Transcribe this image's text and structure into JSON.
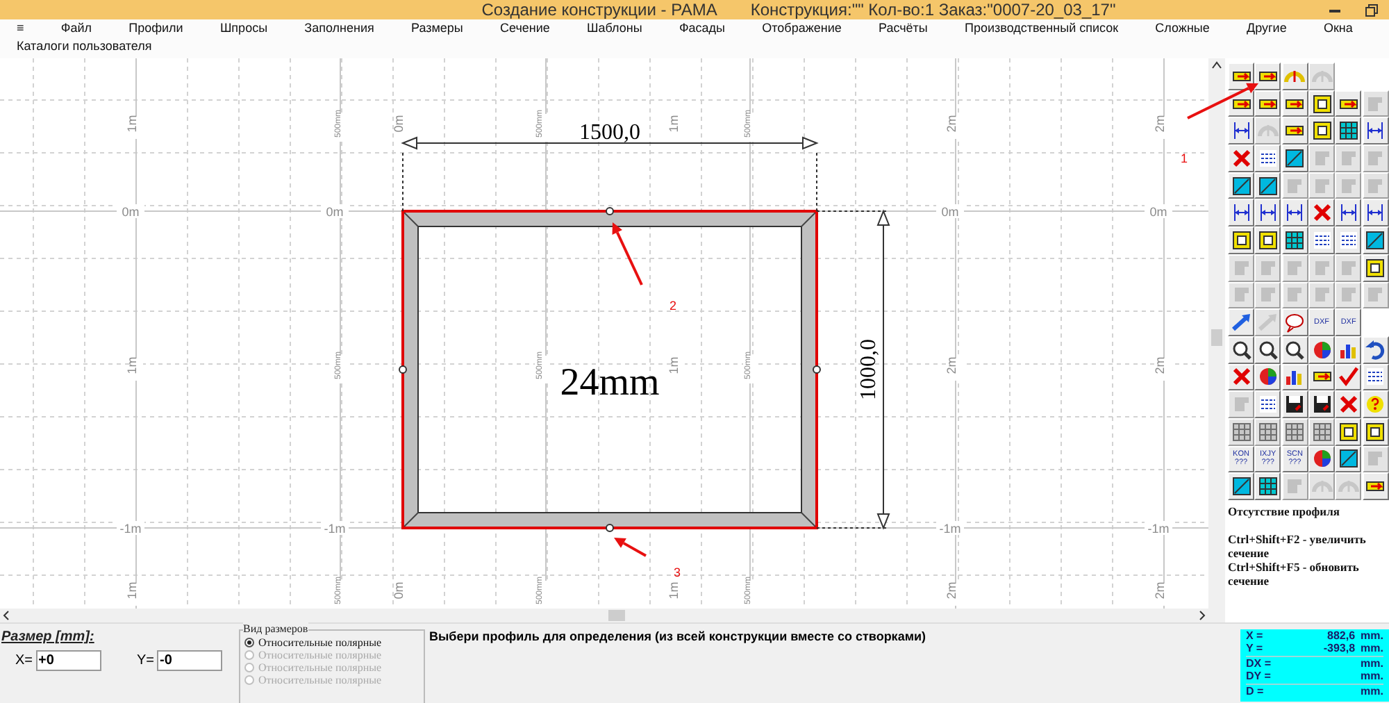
{
  "window": {
    "title": "Создание конструкции - РАМА",
    "info": "Конструкция:\"\" Кол-во:1 Заказ:\"0007-20_03_17\""
  },
  "menu": [
    "≡",
    "Файл",
    "Профили",
    "Шпросы",
    "Заполнения",
    "Размеры",
    "Сечение",
    "Шаблоны",
    "Фасады",
    "Отображение",
    "Расчёты",
    "Производственный список",
    "Сложные",
    "Другие",
    "Окна"
  ],
  "menu_row2": [
    "Каталоги пользователя"
  ],
  "canvas": {
    "grid": {
      "h_lines": [
        {
          "labels": [
            "0m",
            "0m",
            "0m",
            "0m"
          ]
        },
        {
          "labels": [
            "-1m",
            "-1m",
            "-1m",
            "-1m"
          ]
        }
      ],
      "v_rows": [
        {
          "labels": [
            "1m",
            "500mm",
            "0m",
            "500mm",
            "1m",
            "500mm",
            "2m",
            "2m"
          ]
        },
        {
          "labels": [
            "1m",
            "500mm",
            "500mm",
            "1m",
            "500mm",
            "2m",
            "2m"
          ]
        },
        {
          "labels": [
            "1m",
            "500mm",
            "0m",
            "500mm",
            "1m",
            "500mm",
            "2m",
            "2m"
          ]
        }
      ]
    },
    "width_dimension": "1500,0",
    "height_dimension": "1000,0",
    "glass_label": "24mm",
    "annotations": [
      {
        "label": "1"
      },
      {
        "label": "2"
      },
      {
        "label": "3"
      }
    ]
  },
  "toolbar": [
    [
      {
        "kind": "bar",
        "disabled": false
      },
      {
        "kind": "bar",
        "disabled": false
      },
      {
        "kind": "arc",
        "disabled": false
      },
      {
        "kind": "arc",
        "disabled": true
      },
      {
        "kind": "empty"
      },
      {
        "kind": "empty"
      }
    ],
    [
      {
        "kind": "bar",
        "disabled": false
      },
      {
        "kind": "bar",
        "disabled": false
      },
      {
        "kind": "bar",
        "disabled": false
      },
      {
        "kind": "frame",
        "disabled": false
      },
      {
        "kind": "bar",
        "disabled": false
      },
      {
        "kind": "shape",
        "disabled": true
      }
    ],
    [
      {
        "kind": "dims",
        "disabled": false
      },
      {
        "kind": "arc",
        "disabled": true
      },
      {
        "kind": "bar",
        "disabled": false
      },
      {
        "kind": "frame",
        "disabled": false
      },
      {
        "kind": "grid",
        "disabled": false
      },
      {
        "kind": "dims",
        "disabled": false
      }
    ],
    [
      {
        "kind": "cross",
        "disabled": false
      },
      {
        "kind": "doc",
        "disabled": false
      },
      {
        "kind": "glass",
        "disabled": false
      },
      {
        "kind": "shape",
        "disabled": true
      },
      {
        "kind": "shape",
        "disabled": true
      },
      {
        "kind": "shape",
        "disabled": true
      }
    ],
    [
      {
        "kind": "glass",
        "disabled": false
      },
      {
        "kind": "glass",
        "disabled": false
      },
      {
        "kind": "shape",
        "disabled": true
      },
      {
        "kind": "shape",
        "disabled": true
      },
      {
        "kind": "shape",
        "disabled": true
      },
      {
        "kind": "shape",
        "disabled": true
      }
    ],
    [
      {
        "kind": "dims",
        "disabled": false
      },
      {
        "kind": "dims",
        "disabled": false
      },
      {
        "kind": "dims",
        "disabled": false
      },
      {
        "kind": "cross",
        "disabled": false
      },
      {
        "kind": "dims",
        "disabled": false
      },
      {
        "kind": "dims",
        "disabled": false
      }
    ],
    [
      {
        "kind": "frame",
        "disabled": false
      },
      {
        "kind": "frame",
        "disabled": false
      },
      {
        "kind": "grid",
        "disabled": false
      },
      {
        "kind": "doc",
        "disabled": false
      },
      {
        "kind": "doc",
        "disabled": false
      },
      {
        "kind": "glass",
        "disabled": false
      }
    ],
    [
      {
        "kind": "shape",
        "disabled": true
      },
      {
        "kind": "shape",
        "disabled": true
      },
      {
        "kind": "shape",
        "disabled": true
      },
      {
        "kind": "shape",
        "disabled": true
      },
      {
        "kind": "shape",
        "disabled": true
      },
      {
        "kind": "frame",
        "disabled": false
      }
    ],
    [
      {
        "kind": "shape",
        "disabled": true
      },
      {
        "kind": "shape",
        "disabled": true
      },
      {
        "kind": "shape",
        "disabled": true
      },
      {
        "kind": "shape",
        "disabled": true
      },
      {
        "kind": "shape",
        "disabled": true
      },
      {
        "kind": "shape",
        "disabled": true
      }
    ],
    [
      {
        "kind": "arrow",
        "disabled": false
      },
      {
        "kind": "arrow",
        "disabled": true
      },
      {
        "kind": "bubble",
        "disabled": false
      },
      {
        "kind": "label",
        "label": "DXF",
        "disabled": false
      },
      {
        "kind": "label",
        "label": "DXF",
        "disabled": false
      },
      {
        "kind": "empty"
      }
    ],
    [
      {
        "kind": "zoom",
        "disabled": false
      },
      {
        "kind": "zoom",
        "disabled": false
      },
      {
        "kind": "zoom",
        "disabled": false
      },
      {
        "kind": "wheel",
        "disabled": false
      },
      {
        "kind": "bars",
        "disabled": false
      },
      {
        "kind": "undo",
        "disabled": false
      }
    ],
    [
      {
        "kind": "cross",
        "disabled": false
      },
      {
        "kind": "wheel",
        "disabled": false
      },
      {
        "kind": "bars",
        "disabled": false
      },
      {
        "kind": "bar",
        "disabled": false
      },
      {
        "kind": "check",
        "disabled": false
      },
      {
        "kind": "doc",
        "disabled": false
      }
    ],
    [
      {
        "kind": "shape",
        "disabled": true
      },
      {
        "kind": "doc",
        "disabled": false
      },
      {
        "kind": "save",
        "disabled": false
      },
      {
        "kind": "save",
        "disabled": false
      },
      {
        "kind": "cross",
        "disabled": false
      },
      {
        "kind": "help",
        "disabled": false
      }
    ],
    [
      {
        "kind": "grid",
        "disabled": true
      },
      {
        "kind": "grid",
        "disabled": true
      },
      {
        "kind": "grid",
        "disabled": true
      },
      {
        "kind": "grid",
        "disabled": true
      },
      {
        "kind": "frame",
        "disabled": false
      },
      {
        "kind": "frame",
        "disabled": false
      }
    ],
    [
      {
        "kind": "label",
        "label": "KON ???",
        "disabled": false
      },
      {
        "kind": "label",
        "label": "IXJY ???",
        "disabled": false
      },
      {
        "kind": "label",
        "label": "SCN ???",
        "disabled": false
      },
      {
        "kind": "wheel",
        "disabled": false
      },
      {
        "kind": "glass",
        "disabled": false
      },
      {
        "kind": "shape",
        "disabled": true
      }
    ],
    [
      {
        "kind": "glass",
        "disabled": false
      },
      {
        "kind": "grid",
        "disabled": false
      },
      {
        "kind": "shape",
        "disabled": true
      },
      {
        "kind": "arc",
        "disabled": true
      },
      {
        "kind": "arc",
        "disabled": true
      },
      {
        "kind": "bar",
        "disabled": false
      }
    ]
  ],
  "hint": {
    "title": "Отсутствие профиля",
    "lines": [
      "Ctrl+Shift+F2 - увеличить сечение",
      "Ctrl+Shift+F5 - обновить сечение"
    ]
  },
  "size_panel": {
    "title": "Размер [mm]:",
    "x_label": "X=",
    "x_value": "+0",
    "y_label": "Y=",
    "y_value": "-0"
  },
  "dimension_view": {
    "title": "Вид размеров",
    "options": [
      {
        "label": "Относительные полярные",
        "selected": true,
        "disabled": false
      },
      {
        "label": "Относительные полярные",
        "selected": false,
        "disabled": true
      },
      {
        "label": "Относительные полярные",
        "selected": false,
        "disabled": true
      },
      {
        "label": "Относительные полярные",
        "selected": false,
        "disabled": true
      }
    ]
  },
  "message": "Выбери профиль для определения (из всей конструкции вместе со створками)",
  "readout": [
    {
      "label": "X =",
      "value": "882,6",
      "unit": "mm."
    },
    {
      "label": "Y =",
      "value": "-393,8",
      "unit": "mm."
    },
    {
      "label": "DX =",
      "unit": "mm."
    },
    {
      "label": "DY =",
      "unit": "mm."
    },
    {
      "label": "D =",
      "unit": "mm."
    }
  ]
}
